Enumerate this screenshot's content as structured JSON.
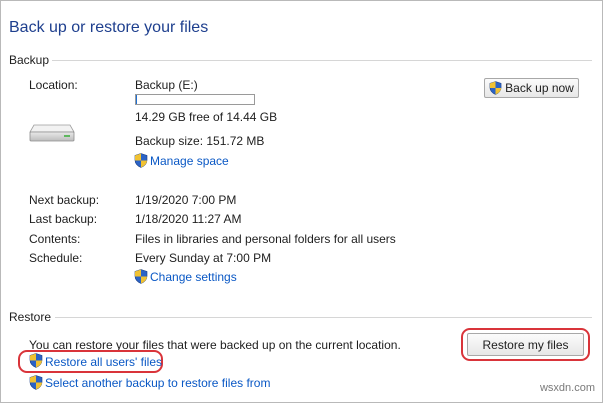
{
  "window": {
    "title": "Back up or restore your files"
  },
  "backup": {
    "section_label": "Backup",
    "location_label": "Location:",
    "location_value": "Backup (E:)",
    "free_space": "14.29 GB free of 14.44 GB",
    "used_fraction": 0.01,
    "backup_size": "Backup size: 151.72 MB",
    "manage_space_link": "Manage space",
    "back_up_now_button": "Back up now",
    "next_backup_label": "Next backup:",
    "next_backup_value": "1/19/2020 7:00 PM",
    "last_backup_label": "Last backup:",
    "last_backup_value": "1/18/2020 11:27 AM",
    "contents_label": "Contents:",
    "contents_value": "Files in libraries and personal folders for all users",
    "schedule_label": "Schedule:",
    "schedule_value": "Every Sunday at 7:00 PM",
    "change_settings_link": "Change settings"
  },
  "restore": {
    "section_label": "Restore",
    "description": "You can restore your files that were backed up on the current location.",
    "restore_my_files_button": "Restore my files",
    "restore_all_users_link": "Restore all users' files",
    "select_another_link": "Select another backup to restore files from"
  },
  "watermark": "wsxdn.com",
  "colors": {
    "title": "#1e3f8e",
    "link": "#0a58c5",
    "highlight": "#d9343a",
    "progress": "#1f6fd1"
  },
  "icons": [
    "uac-shield-icon",
    "drive-icon"
  ]
}
